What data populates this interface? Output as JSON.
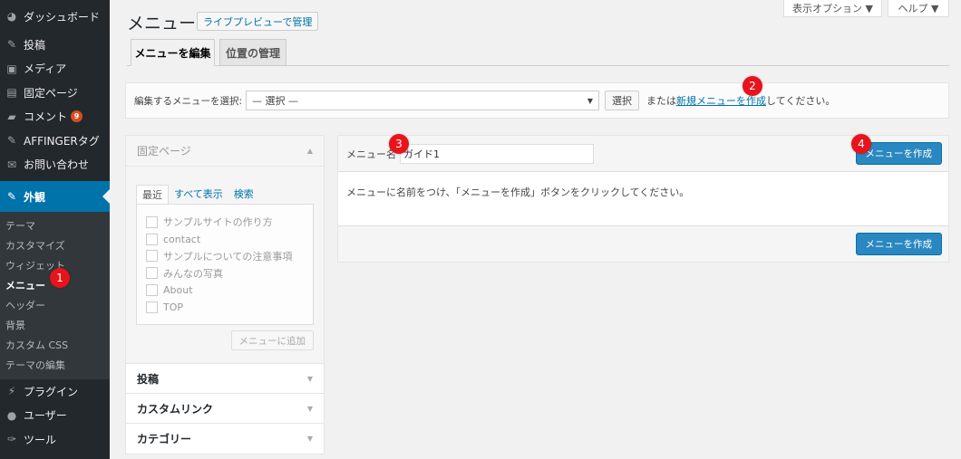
{
  "sidebar": {
    "items_top": [
      {
        "label": "ダッシュボード",
        "icon": "dashboard-icon",
        "glyph": "◕"
      },
      {
        "label": "投稿",
        "icon": "pin-icon",
        "glyph": "✎"
      },
      {
        "label": "メディア",
        "icon": "media-icon",
        "glyph": "▣"
      },
      {
        "label": "固定ページ",
        "icon": "page-icon",
        "glyph": "▤"
      },
      {
        "label": "コメント",
        "icon": "comment-icon",
        "glyph": "▰",
        "badge": "9"
      },
      {
        "label": "AFFINGERタグ",
        "icon": "pin-icon",
        "glyph": "✎"
      },
      {
        "label": "お問い合わせ",
        "icon": "mail-icon",
        "glyph": "✉"
      }
    ],
    "active": {
      "label": "外観",
      "icon": "appearance-icon",
      "glyph": "✎"
    },
    "submenu": [
      "テーマ",
      "カスタマイズ",
      "ウィジェット",
      "メニュー",
      "ヘッダー",
      "背景",
      "カスタム CSS",
      "テーマの編集"
    ],
    "items_bottom": [
      {
        "label": "プラグイン",
        "icon": "plugin-icon",
        "glyph": "⚡"
      },
      {
        "label": "ユーザー",
        "icon": "user-icon",
        "glyph": "●"
      },
      {
        "label": "ツール",
        "icon": "wrench-icon",
        "glyph": "✑"
      }
    ]
  },
  "header": {
    "screen_options": "表示オプション ▼",
    "help": "ヘルプ ▼",
    "title": "メニュー",
    "live_preview": "ライブプレビューで管理"
  },
  "tabs": [
    "メニューを編集",
    "位置の管理"
  ],
  "select_bar": {
    "label": "編集するメニューを選択:",
    "selected": "— 選択 —",
    "select_button": "選択",
    "or_text": "または",
    "new_link": "新規メニューを作成",
    "suffix": "してください。"
  },
  "accordion": {
    "fixed_pages": "固定ページ",
    "inner_tabs": [
      "最近",
      "すべて表示",
      "検索"
    ],
    "pages": [
      "サンプルサイトの作り方",
      "contact",
      "サンプルについての注意事項",
      "みんなの写真",
      "About",
      "TOP"
    ],
    "add_button": "メニューに追加",
    "sections": [
      "投稿",
      "カスタムリンク",
      "カテゴリー"
    ]
  },
  "edit_panel": {
    "name_label": "メニュー名",
    "name_value": "ガイド1",
    "create_button": "メニューを作成",
    "instruction": "メニューに名前をつけ、「メニューを作成」ボタンをクリックしてください。"
  },
  "markers": [
    "1",
    "2",
    "3",
    "4"
  ],
  "colors": {
    "accent": "#0073aa",
    "sidebar": "#23282d",
    "marker": "#e8131b"
  }
}
